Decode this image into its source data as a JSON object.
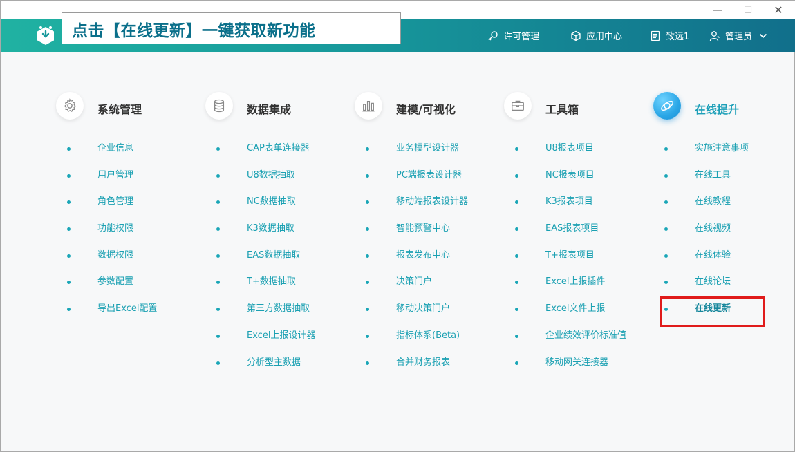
{
  "window": {
    "minimize": "—",
    "maximize": "☐",
    "close": "✕"
  },
  "banner": {
    "text": "点击【在线更新】一键获取新功能"
  },
  "header_nav": {
    "license": "许可管理",
    "app_center": "应用中心",
    "tenant": "致远1",
    "user": "管理员"
  },
  "columns": [
    {
      "title": "系统管理",
      "icon": "gear-icon",
      "items": [
        "企业信息",
        "用户管理",
        "角色管理",
        "功能权限",
        "数据权限",
        "参数配置",
        "导出Excel配置"
      ]
    },
    {
      "title": "数据集成",
      "icon": "database-icon",
      "items": [
        "CAP表单连接器",
        "U8数据抽取",
        "NC数据抽取",
        "K3数据抽取",
        "EAS数据抽取",
        "T+数据抽取",
        "第三方数据抽取",
        "Excel上报设计器",
        "分析型主数据"
      ]
    },
    {
      "title": "建模/可视化",
      "icon": "bar-chart-icon",
      "items": [
        "业务模型设计器",
        "PC端报表设计器",
        "移动端报表设计器",
        "智能预警中心",
        "报表发布中心",
        "决策门户",
        "移动决策门户",
        "指标体系(Beta)",
        "合并财务报表"
      ]
    },
    {
      "title": "工具箱",
      "icon": "toolbox-icon",
      "items": [
        "U8报表项目",
        "NC报表项目",
        "K3报表项目",
        "EAS报表项目",
        "T+报表项目",
        "Excel上报插件",
        "Excel文件上报",
        "企业绩效评价标准值",
        "移动网关连接器"
      ]
    },
    {
      "title": "在线提升",
      "icon": "rocket-icon",
      "items": [
        "实施注意事项",
        "在线工具",
        "在线教程",
        "在线视频",
        "在线体验",
        "在线论坛",
        "在线更新"
      ]
    }
  ],
  "colors": {
    "accent": "#1aa0b2",
    "header_start": "#20b2a2",
    "header_end": "#116f8b",
    "highlight": "#e01b1b"
  }
}
